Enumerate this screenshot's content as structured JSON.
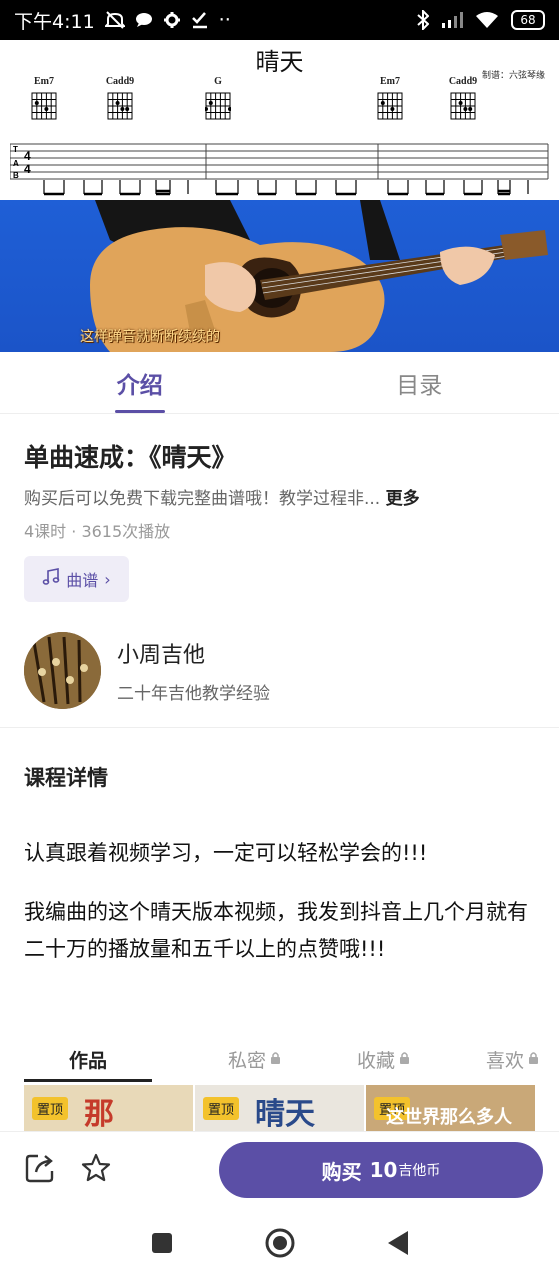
{
  "status_bar": {
    "time": "下午4:11",
    "dots": "··",
    "battery": "68",
    "icons": [
      "mute-icon",
      "chat-icon",
      "gear-icon",
      "check-icon",
      "bluetooth-icon",
      "signal-icon",
      "wifi-icon",
      "battery-icon"
    ]
  },
  "sheet": {
    "title": "晴天",
    "credit": "制谱：六弦琴缘",
    "chords": [
      "Em7",
      "Cadd9",
      "G",
      "Em7",
      "Cadd9"
    ]
  },
  "video": {
    "subtitle": "这样弹音就断断续续的"
  },
  "tabs": {
    "intro": "介绍",
    "catalog": "目录"
  },
  "course": {
    "title": "单曲速成：《晴天》",
    "description": "购买后可以免费下载完整曲谱哦！教学过程非...",
    "more": "更多",
    "stats": "4课时 · 3615次播放",
    "score_button": "曲谱"
  },
  "teacher": {
    "name": "小周吉他",
    "bio": "二十年吉他教学经验"
  },
  "detail": {
    "heading": "课程详情",
    "p1": "认真跟着视频学习，一定可以轻松学会的!!!",
    "p2": "我编曲的这个晴天版本视频，我发到抖音上几个月就有二十万的播放量和五千以上的点赞哦!!!"
  },
  "works_tabs": {
    "works": "作品",
    "private": "私密",
    "favorites": "收藏",
    "likes": "喜欢"
  },
  "thumbnails": [
    {
      "pin": "置顶",
      "text": "那"
    },
    {
      "pin": "置顶",
      "text": "晴天"
    },
    {
      "pin": "置顶",
      "text": "这世界那么多人"
    }
  ],
  "bottom_bar": {
    "buy_label": "购买",
    "price": "10",
    "currency": "吉他币"
  },
  "colors": {
    "accent": "#5b4fa6",
    "video_bg": "#1f5fd6",
    "pin_badge": "#f3c22c"
  }
}
